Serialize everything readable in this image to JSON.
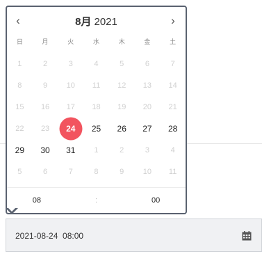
{
  "picker": {
    "prev_label": "‹",
    "next_label": "›",
    "month": "8月",
    "year": "2021",
    "weekdays": [
      "日",
      "月",
      "火",
      "水",
      "木",
      "金",
      "土"
    ],
    "weeks": [
      [
        {
          "d": "1",
          "cur": false
        },
        {
          "d": "2",
          "cur": false
        },
        {
          "d": "3",
          "cur": false
        },
        {
          "d": "4",
          "cur": false
        },
        {
          "d": "5",
          "cur": false
        },
        {
          "d": "6",
          "cur": false
        },
        {
          "d": "7",
          "cur": false
        }
      ],
      [
        {
          "d": "8",
          "cur": false
        },
        {
          "d": "9",
          "cur": false
        },
        {
          "d": "10",
          "cur": false
        },
        {
          "d": "11",
          "cur": false
        },
        {
          "d": "12",
          "cur": false
        },
        {
          "d": "13",
          "cur": false
        },
        {
          "d": "14",
          "cur": false
        }
      ],
      [
        {
          "d": "15",
          "cur": false
        },
        {
          "d": "16",
          "cur": false
        },
        {
          "d": "17",
          "cur": false
        },
        {
          "d": "18",
          "cur": false
        },
        {
          "d": "19",
          "cur": false
        },
        {
          "d": "20",
          "cur": false
        },
        {
          "d": "21",
          "cur": false
        }
      ],
      [
        {
          "d": "22",
          "cur": false
        },
        {
          "d": "23",
          "cur": false
        },
        {
          "d": "24",
          "cur": true,
          "selected": true
        },
        {
          "d": "25",
          "cur": true
        },
        {
          "d": "26",
          "cur": true
        },
        {
          "d": "27",
          "cur": true
        },
        {
          "d": "28",
          "cur": true
        }
      ],
      [
        {
          "d": "29",
          "cur": true
        },
        {
          "d": "30",
          "cur": true
        },
        {
          "d": "31",
          "cur": true
        },
        {
          "d": "1",
          "cur": false
        },
        {
          "d": "2",
          "cur": false
        },
        {
          "d": "3",
          "cur": false
        },
        {
          "d": "4",
          "cur": false
        }
      ],
      [
        {
          "d": "5",
          "cur": false
        },
        {
          "d": "6",
          "cur": false
        },
        {
          "d": "7",
          "cur": false
        },
        {
          "d": "8",
          "cur": false
        },
        {
          "d": "9",
          "cur": false
        },
        {
          "d": "10",
          "cur": false
        },
        {
          "d": "11",
          "cur": false
        }
      ]
    ],
    "time": {
      "hour": "08",
      "separator": ":",
      "minute": "00"
    },
    "selected_color": "#f2545f",
    "border_color": "#5a6270"
  },
  "input": {
    "value": "2021-08-24  08:00",
    "icon": "calendar-icon"
  }
}
